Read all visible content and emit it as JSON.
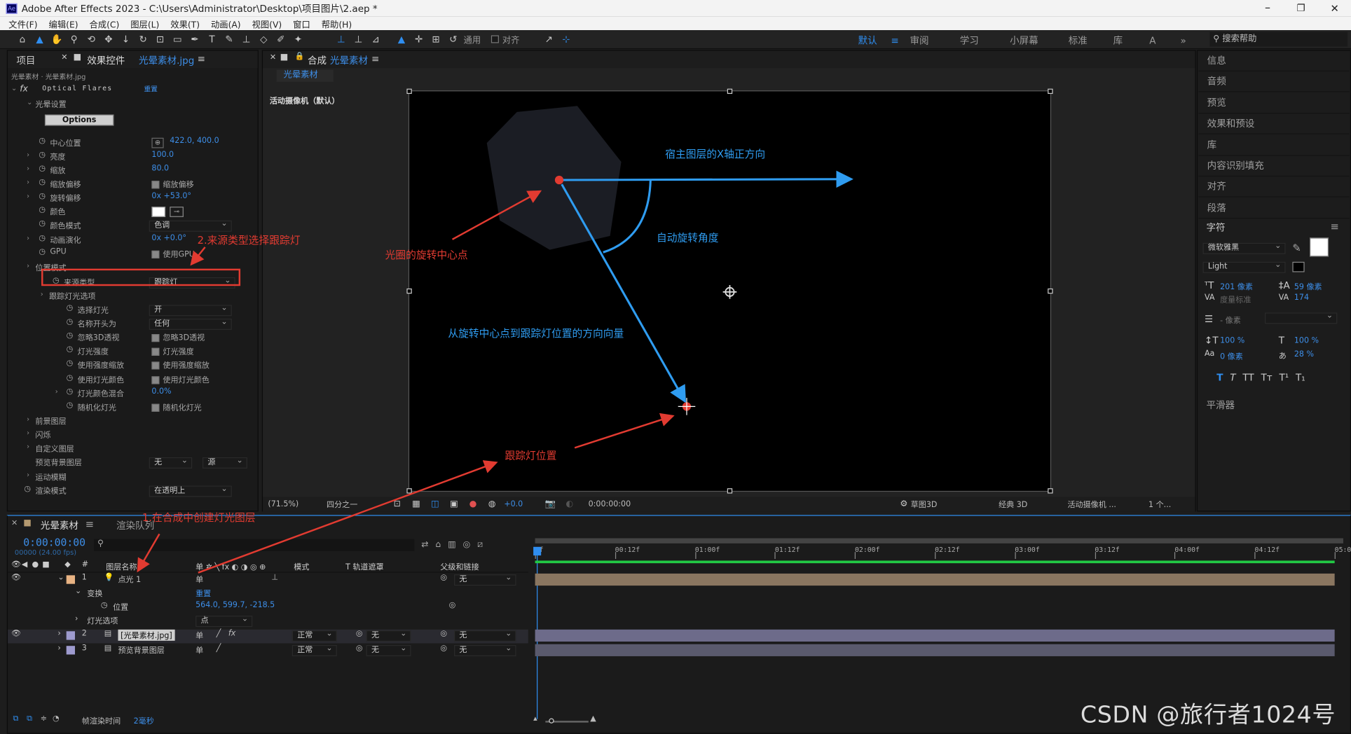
{
  "window": {
    "title": "Adobe After Effects 2023 - C:\\Users\\Administrator\\Desktop\\项目图片\\2.aep *",
    "controls": [
      "–",
      "❐",
      "✕"
    ]
  },
  "menu": [
    "文件(F)",
    "编辑(E)",
    "合成(C)",
    "图层(L)",
    "效果(T)",
    "动画(A)",
    "视图(V)",
    "窗口",
    "帮助(H)"
  ],
  "toolbar": {
    "snap_label": "通用",
    "align_label": "对齐",
    "workspaces": [
      "默认",
      "审阅",
      "学习",
      "小屏幕",
      "标准",
      "库",
      "A"
    ],
    "search_placeholder": "搜索帮助"
  },
  "effect_panel": {
    "tabs": {
      "project": "项目",
      "effects": "效果控件",
      "effects_file": "光晕素材.jpg"
    },
    "breadcrumb": "光晕素材 · 光晕素材.jpg",
    "effect_name": "Optical Flares",
    "reset": "重置",
    "flare_settings": "光晕设置",
    "options_button": "Options",
    "props": [
      {
        "label": "中心位置",
        "value": "422.0, 400.0"
      },
      {
        "label": "亮度",
        "value": "100.0"
      },
      {
        "label": "缩放",
        "value": "80.0"
      },
      {
        "label": "缩放偏移",
        "value": "缩放偏移"
      },
      {
        "label": "旋转偏移",
        "value": "0x +53.0°"
      },
      {
        "label": "颜色",
        "value": ""
      },
      {
        "label": "颜色模式",
        "value": "色调"
      },
      {
        "label": "动画演化",
        "value": "0x +0.0°"
      },
      {
        "label": "GPU",
        "value": "使用GPU"
      },
      {
        "label": "位置模式",
        "value": ""
      },
      {
        "label": "来源类型",
        "value": "跟踪灯"
      },
      {
        "label": "跟踪灯光选项",
        "value": ""
      },
      {
        "label": "选择灯光",
        "value": "开"
      },
      {
        "label": "名称开头为",
        "value": "任何"
      },
      {
        "label": "忽略3D透视",
        "value": "忽略3D透视"
      },
      {
        "label": "灯光强度",
        "value": "灯光强度"
      },
      {
        "label": "使用强度缩放",
        "value": "使用强度缩放"
      },
      {
        "label": "使用灯光颜色",
        "value": "使用灯光颜色"
      },
      {
        "label": "灯光颜色混合",
        "value": "0.0%"
      },
      {
        "label": "随机化灯光",
        "value": "随机化灯光"
      },
      {
        "label": "前景图层",
        "value": ""
      },
      {
        "label": "闪烁",
        "value": ""
      },
      {
        "label": "自定义图层",
        "value": ""
      },
      {
        "label": "预览背景图层",
        "value": "无"
      },
      {
        "label": "运动模糊",
        "value": ""
      },
      {
        "label": "渲染模式",
        "value": "在透明上"
      }
    ],
    "preview_source": "源"
  },
  "composition": {
    "tab": "合成",
    "tab_name": "光晕素材",
    "subtab": "光晕素材",
    "camera": "活动摄像机（默认）",
    "footer": {
      "zoom": "(71.5%)",
      "resolution": "四分之一",
      "exposure": "+0.0",
      "timecode": "0:00:00:00",
      "draft3d": "草图3D",
      "renderer": "经典 3D",
      "camera": "活动摄像机 ...",
      "views": "1 个..."
    }
  },
  "annotations": {
    "x_axis": "宿主图层的X轴正方向",
    "auto_rotate": "自动旋转角度",
    "center": "光圈的旋转中心点",
    "vector": "从旋转中心点到跟踪灯位置的方向向量",
    "light_pos": "跟踪灯位置",
    "step1": "1.在合成中创建灯光图层",
    "step2": "2.来源类型选择跟踪灯"
  },
  "right_panel": {
    "items": [
      "信息",
      "音频",
      "预览",
      "效果和预设",
      "库",
      "内容识别填充",
      "对齐",
      "段落"
    ],
    "char_title": "字符",
    "font": "微软雅黑",
    "style": "Light",
    "size": "201 像素",
    "leading": "59 像素",
    "kerning": "度量标准",
    "tracking": "174",
    "stroke": "- 像素",
    "vscale": "100 %",
    "hscale": "100 %",
    "baseline": "0 像素",
    "tsume": "28 %",
    "smoother": "平滑器"
  },
  "timeline": {
    "tab": "光晕素材",
    "render_queue": "渲染队列",
    "timecode": "0:00:00:00",
    "fps": "00000 (24.00 fps)",
    "headers": {
      "num": "#",
      "name": "图层名称",
      "mode": "模式",
      "trkmat": "T  轨道遮罩",
      "parent": "父级和链接"
    },
    "ruler": [
      "0f",
      "00:12f",
      "01:00f",
      "01:12f",
      "02:00f",
      "02:12f",
      "03:00f",
      "03:12f",
      "04:00f",
      "04:12f",
      "05:0"
    ],
    "layers": [
      {
        "num": "1",
        "name": "点光 1",
        "parent": "无"
      },
      {
        "num": "2",
        "name": "[光晕素材.jpg]",
        "mode": "正常",
        "mat": "无",
        "parent": "无"
      },
      {
        "num": "3",
        "name": "预览背景图层",
        "mode": "正常",
        "mat": "无",
        "parent": "无"
      }
    ],
    "transform": "变换",
    "transform_reset": "重置",
    "position": "位置",
    "position_value": "564.0, 599.7, -218.5",
    "light_options": "灯光选项",
    "light_type": "点",
    "render_time_label": "帧渲染时间",
    "render_time": "2毫秒"
  },
  "watermark": "CSDN @旅行者1024号"
}
